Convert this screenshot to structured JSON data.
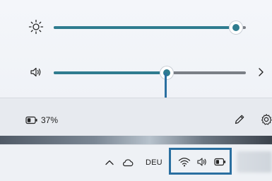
{
  "quick_settings": {
    "brightness": {
      "level_percent": 95,
      "icon": "brightness-icon"
    },
    "volume": {
      "level_percent": 59,
      "icon": "speaker-icon",
      "expand_icon": "chevron-right-icon"
    },
    "battery": {
      "label": "37%",
      "icon": "battery-icon"
    },
    "actions": {
      "edit_icon": "pencil-icon",
      "settings_icon": "gear-icon"
    }
  },
  "taskbar": {
    "language": "DEU",
    "tray_icons": [
      "chevron-up-icon",
      "cloud-icon",
      "wifi-icon",
      "speaker-icon",
      "battery-icon"
    ]
  },
  "colors": {
    "accent": "#2f7c8f",
    "highlight": "#2a6fa0"
  }
}
